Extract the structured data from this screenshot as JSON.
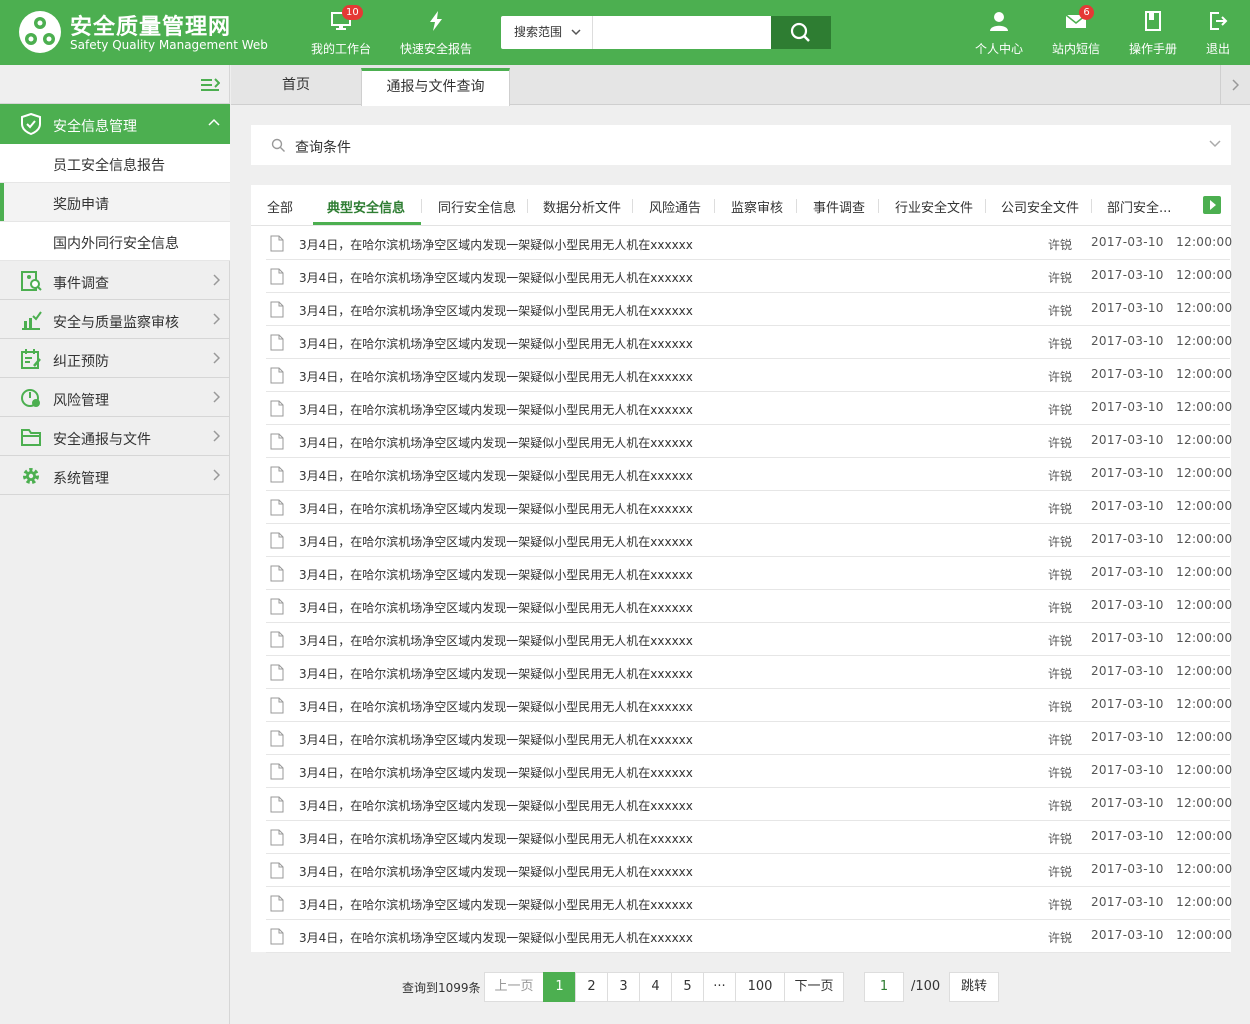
{
  "header": {
    "title": "安全质量管理网",
    "subtitle": "Safety Quality Management Web",
    "workbench": {
      "label": "我的工作台",
      "badge": "10"
    },
    "quick_report": {
      "label": "快速安全报告"
    },
    "search": {
      "scope": "搜索范围",
      "placeholder": ""
    },
    "personal": {
      "label": "个人中心"
    },
    "messages": {
      "label": "站内短信",
      "badge": "6"
    },
    "manual": {
      "label": "操作手册"
    },
    "logout": {
      "label": "退出"
    }
  },
  "sidebar": {
    "active_menu": "安全信息管理",
    "sub_items": [
      "员工安全信息报告",
      "奖励申请",
      "国内外同行安全信息"
    ],
    "selected_sub": "奖励申请",
    "menus": [
      "事件调查",
      "安全与质量监察审核",
      "纠正预防",
      "风险管理",
      "安全通报与文件",
      "系统管理"
    ]
  },
  "tabs": {
    "home": "首页",
    "active": "通报与文件查询"
  },
  "query": {
    "label": "查询条件"
  },
  "categories": [
    "全部",
    "典型安全信息",
    "同行安全信息",
    "数据分析文件",
    "风险通告",
    "监察审核",
    "事件调查",
    "行业安全文件",
    "公司安全文件",
    "部门安全..."
  ],
  "active_category": "典型安全信息",
  "rows": [
    {
      "title": "3月4日，在哈尔滨机场净空区域内发现一架疑似小型民用无人机在xxxxxx",
      "author": "许锐",
      "date": "2017-03-10",
      "time": "12:00:00"
    },
    {
      "title": "3月4日，在哈尔滨机场净空区域内发现一架疑似小型民用无人机在xxxxxx",
      "author": "许锐",
      "date": "2017-03-10",
      "time": "12:00:00"
    },
    {
      "title": "3月4日，在哈尔滨机场净空区域内发现一架疑似小型民用无人机在xxxxxx",
      "author": "许锐",
      "date": "2017-03-10",
      "time": "12:00:00"
    },
    {
      "title": "3月4日，在哈尔滨机场净空区域内发现一架疑似小型民用无人机在xxxxxx",
      "author": "许锐",
      "date": "2017-03-10",
      "time": "12:00:00"
    },
    {
      "title": "3月4日，在哈尔滨机场净空区域内发现一架疑似小型民用无人机在xxxxxx",
      "author": "许锐",
      "date": "2017-03-10",
      "time": "12:00:00"
    },
    {
      "title": "3月4日，在哈尔滨机场净空区域内发现一架疑似小型民用无人机在xxxxxx",
      "author": "许锐",
      "date": "2017-03-10",
      "time": "12:00:00"
    },
    {
      "title": "3月4日，在哈尔滨机场净空区域内发现一架疑似小型民用无人机在xxxxxx",
      "author": "许锐",
      "date": "2017-03-10",
      "time": "12:00:00"
    },
    {
      "title": "3月4日，在哈尔滨机场净空区域内发现一架疑似小型民用无人机在xxxxxx",
      "author": "许锐",
      "date": "2017-03-10",
      "time": "12:00:00"
    },
    {
      "title": "3月4日，在哈尔滨机场净空区域内发现一架疑似小型民用无人机在xxxxxx",
      "author": "许锐",
      "date": "2017-03-10",
      "time": "12:00:00"
    },
    {
      "title": "3月4日，在哈尔滨机场净空区域内发现一架疑似小型民用无人机在xxxxxx",
      "author": "许锐",
      "date": "2017-03-10",
      "time": "12:00:00"
    },
    {
      "title": "3月4日，在哈尔滨机场净空区域内发现一架疑似小型民用无人机在xxxxxx",
      "author": "许锐",
      "date": "2017-03-10",
      "time": "12:00:00"
    },
    {
      "title": "3月4日，在哈尔滨机场净空区域内发现一架疑似小型民用无人机在xxxxxx",
      "author": "许锐",
      "date": "2017-03-10",
      "time": "12:00:00"
    },
    {
      "title": "3月4日，在哈尔滨机场净空区域内发现一架疑似小型民用无人机在xxxxxx",
      "author": "许锐",
      "date": "2017-03-10",
      "time": "12:00:00"
    },
    {
      "title": "3月4日，在哈尔滨机场净空区域内发现一架疑似小型民用无人机在xxxxxx",
      "author": "许锐",
      "date": "2017-03-10",
      "time": "12:00:00"
    },
    {
      "title": "3月4日，在哈尔滨机场净空区域内发现一架疑似小型民用无人机在xxxxxx",
      "author": "许锐",
      "date": "2017-03-10",
      "time": "12:00:00"
    },
    {
      "title": "3月4日，在哈尔滨机场净空区域内发现一架疑似小型民用无人机在xxxxxx",
      "author": "许锐",
      "date": "2017-03-10",
      "time": "12:00:00"
    },
    {
      "title": "3月4日，在哈尔滨机场净空区域内发现一架疑似小型民用无人机在xxxxxx",
      "author": "许锐",
      "date": "2017-03-10",
      "time": "12:00:00"
    },
    {
      "title": "3月4日，在哈尔滨机场净空区域内发现一架疑似小型民用无人机在xxxxxx",
      "author": "许锐",
      "date": "2017-03-10",
      "time": "12:00:00"
    },
    {
      "title": "3月4日，在哈尔滨机场净空区域内发现一架疑似小型民用无人机在xxxxxx",
      "author": "许锐",
      "date": "2017-03-10",
      "time": "12:00:00"
    },
    {
      "title": "3月4日，在哈尔滨机场净空区域内发现一架疑似小型民用无人机在xxxxxx",
      "author": "许锐",
      "date": "2017-03-10",
      "time": "12:00:00"
    },
    {
      "title": "3月4日，在哈尔滨机场净空区域内发现一架疑似小型民用无人机在xxxxxx",
      "author": "许锐",
      "date": "2017-03-10",
      "time": "12:00:00"
    },
    {
      "title": "3月4日，在哈尔滨机场净空区域内发现一架疑似小型民用无人机在xxxxxx",
      "author": "许锐",
      "date": "2017-03-10",
      "time": "12:00:00"
    }
  ],
  "pagination": {
    "total": "查询到1099条",
    "prev": "上一页",
    "pages": [
      "1",
      "2",
      "3",
      "4",
      "5",
      "···",
      "100"
    ],
    "current": "1",
    "next": "下一页",
    "input": "1",
    "total_pages": "/100",
    "jump": "跳转"
  },
  "colors": {
    "primary": "#4caf50",
    "primary_dark": "#2e7d32",
    "badge": "#e53935"
  }
}
